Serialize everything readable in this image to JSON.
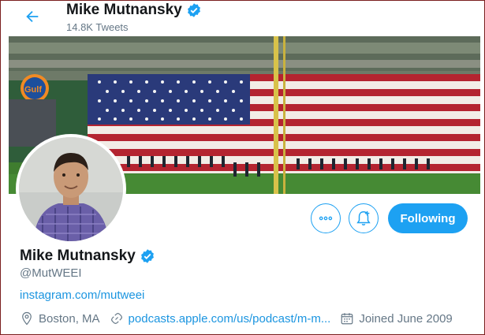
{
  "header": {
    "name": "Mike Mutnansky",
    "tweet_count": "14.8K Tweets"
  },
  "profile": {
    "name": "Mike Mutnansky",
    "handle": "@MutWEEI",
    "bio_link": "instagram.com/mutweei",
    "location": "Boston, MA",
    "website": "podcasts.apple.com/us/podcast/m-m...",
    "joined": "Joined June 2009",
    "verified": true
  },
  "actions": {
    "follow_label": "Following"
  },
  "colors": {
    "accent": "#1da1f2",
    "link": "#1b95e0",
    "muted": "#657786",
    "text": "#14171a"
  },
  "icons": [
    "back-arrow-icon",
    "verified-badge-icon",
    "more-icon",
    "notification-bell-icon",
    "location-icon",
    "link-icon",
    "calendar-icon"
  ]
}
